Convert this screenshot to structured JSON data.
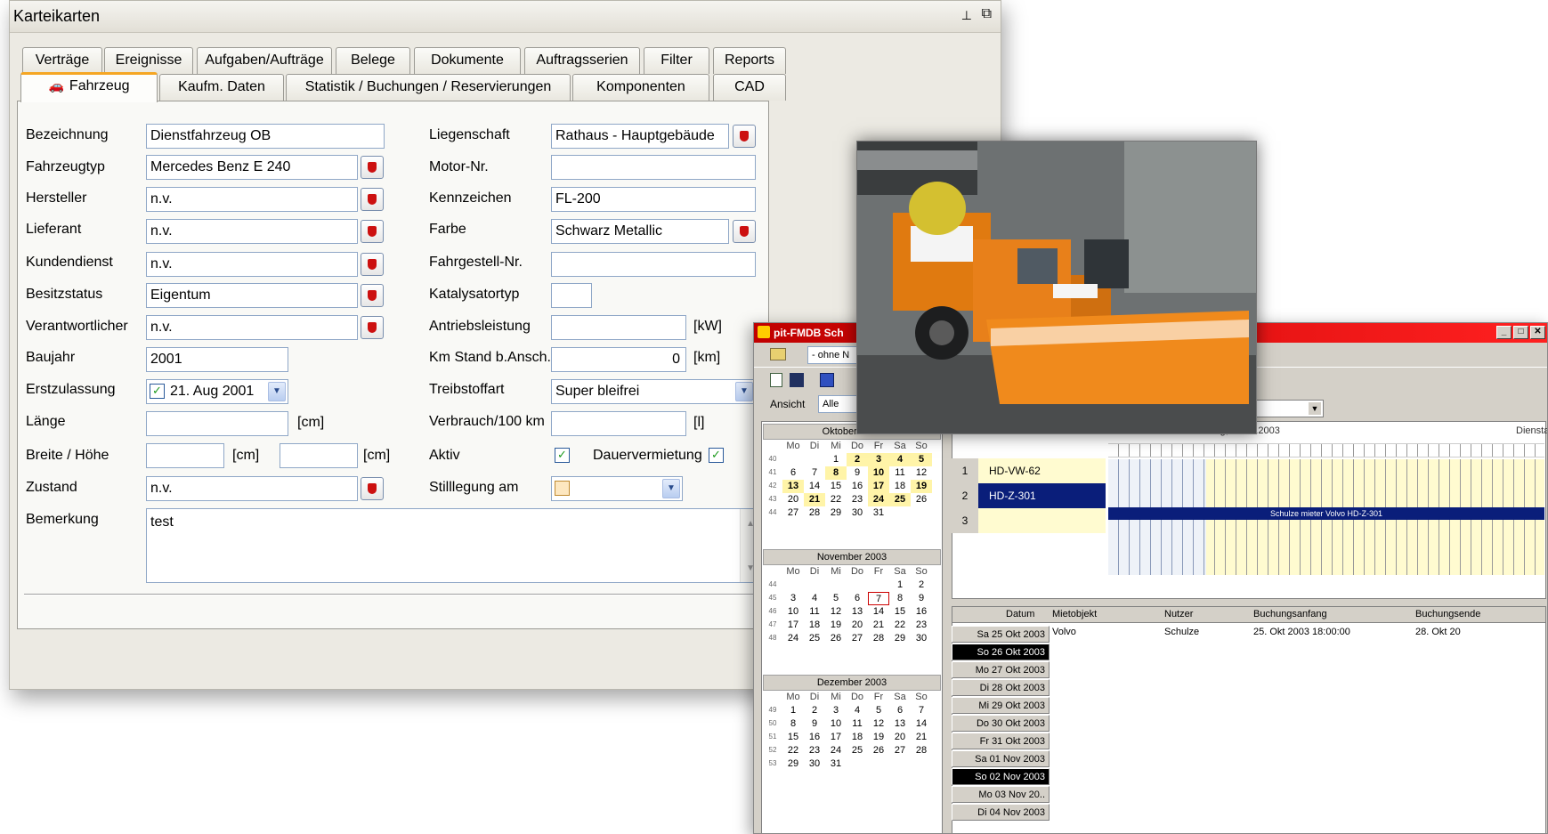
{
  "main_window": {
    "title": "Karteikarten",
    "tabs_row1": [
      "Verträge",
      "Ereignisse",
      "Aufgaben/Aufträge",
      "Belege",
      "Dokumente",
      "Auftragsserien",
      "Filter",
      "Reports"
    ],
    "tabs_row2": [
      "Fahrzeug",
      "Kaufm. Daten",
      "Statistik / Buchungen / Reservierungen",
      "Komponenten",
      "CAD"
    ],
    "form": {
      "bezeichnung_label": "Bezeichnung",
      "bezeichnung": "Dienstfahrzeug OB",
      "fahrzeugtyp_label": "Fahrzeugtyp",
      "fahrzeugtyp": "Mercedes Benz E 240",
      "hersteller_label": "Hersteller",
      "hersteller": "n.v.",
      "lieferant_label": "Lieferant",
      "lieferant": "n.v.",
      "kundendienst_label": "Kundendienst",
      "kundendienst": "n.v.",
      "besitzstatus_label": "Besitzstatus",
      "besitzstatus": "Eigentum",
      "verantwortlicher_label": "Verantwortlicher",
      "verantwortlicher": "n.v.",
      "baujahr_label": "Baujahr",
      "baujahr": "2001",
      "erstzulassung_label": "Erstzulassung",
      "erstzulassung": "21. Aug 2001",
      "laenge_label": "Länge",
      "laenge_unit": "[cm]",
      "breite_label": "Breite / Höhe",
      "breite_unit": "[cm]",
      "hoehe_unit": "[cm]",
      "zustand_label": "Zustand",
      "zustand": "n.v.",
      "bemerkung_label": "Bemerkung",
      "bemerkung": "test",
      "liegenschaft_label": "Liegenschaft",
      "liegenschaft": "Rathaus - Hauptgebäude",
      "motornr_label": "Motor-Nr.",
      "kennzeichen_label": "Kennzeichen",
      "kennzeichen": "FL-200",
      "farbe_label": "Farbe",
      "farbe": "Schwarz Metallic",
      "fahrgestell_label": "Fahrgestell-Nr.",
      "katalysator_label": "Katalysatortyp",
      "antrieb_label": "Antriebsleistung",
      "antrieb_unit": "[kW]",
      "kmstand_label": "Km Stand b.Ansch.",
      "kmstand": "0",
      "kmstand_unit": "[km]",
      "treibstoff_label": "Treibstoffart",
      "treibstoff": "Super bleifrei",
      "verbrauch_label": "Verbrauch/100 km",
      "verbrauch_unit": "[l]",
      "aktiv_label": "Aktiv",
      "dauervermietung_label": "Dauervermietung",
      "stilllegung_label": "Stilllegung am"
    }
  },
  "back_window": {
    "title": "pit-FMDB Sch",
    "ansicht_label": "Ansicht",
    "ansicht_value": "Alle",
    "filter_value": "- ohne N",
    "calendar": [
      {
        "month": "Oktober 2003",
        "weekdays": [
          "Mo",
          "Di",
          "Mi",
          "Do",
          "Fr",
          "Sa",
          "So"
        ],
        "weeks": [
          [
            "40",
            "",
            "",
            "1",
            "2",
            "3",
            "4",
            "5"
          ],
          [
            "41",
            "6",
            "7",
            "8",
            "9",
            "10",
            "11",
            "12"
          ],
          [
            "42",
            "13",
            "14",
            "15",
            "16",
            "17",
            "18",
            "19"
          ],
          [
            "43",
            "20",
            "21",
            "22",
            "23",
            "24",
            "25",
            "26"
          ],
          [
            "44",
            "27",
            "28",
            "29",
            "30",
            "31",
            "",
            ""
          ]
        ]
      },
      {
        "month": "November 2003",
        "weekdays": [
          "Mo",
          "Di",
          "Mi",
          "Do",
          "Fr",
          "Sa",
          "So"
        ],
        "weeks": [
          [
            "44",
            "",
            "",
            "",
            "",
            "",
            "1",
            "2"
          ],
          [
            "45",
            "3",
            "4",
            "5",
            "6",
            "7",
            "8",
            "9"
          ],
          [
            "46",
            "10",
            "11",
            "12",
            "13",
            "14",
            "15",
            "16"
          ],
          [
            "47",
            "17",
            "18",
            "19",
            "20",
            "21",
            "22",
            "23"
          ],
          [
            "48",
            "24",
            "25",
            "26",
            "27",
            "28",
            "29",
            "30"
          ]
        ]
      },
      {
        "month": "Dezember 2003",
        "weekdays": [
          "Mo",
          "Di",
          "Mi",
          "Do",
          "Fr",
          "Sa",
          "So"
        ],
        "weeks": [
          [
            "49",
            "1",
            "2",
            "3",
            "4",
            "5",
            "6",
            "7"
          ],
          [
            "50",
            "8",
            "9",
            "10",
            "11",
            "12",
            "13",
            "14"
          ],
          [
            "51",
            "15",
            "16",
            "17",
            "18",
            "19",
            "20",
            "21"
          ],
          [
            "52",
            "22",
            "23",
            "24",
            "25",
            "26",
            "27",
            "28"
          ],
          [
            "53",
            "29",
            "30",
            "31",
            "",
            "",
            "",
            ""
          ]
        ]
      }
    ],
    "timeline_header": "Montag, 27.10.2003",
    "timeline_header2": "Dienstag",
    "rows": [
      {
        "num": "1",
        "plate": "HD-VW-62"
      },
      {
        "num": "2",
        "plate": "HD-Z-301"
      },
      {
        "num": "3",
        "plate": ""
      }
    ],
    "booking_bar": "Schulze mieter Volvo HD-Z-301",
    "table_headers": [
      "Datum",
      "Mietobjekt",
      "Nutzer",
      "Buchungsanfang",
      "Buchungsende"
    ],
    "first_booking": {
      "mietobjekt": "Volvo",
      "nutzer": "Schulze",
      "anfang": "25. Okt 2003 18:00:00",
      "ende": "28. Okt 20"
    },
    "dates": [
      "Sa 25 Okt 2003",
      "So 26 Okt 2003",
      "Mo 27 Okt 2003",
      "Di 28 Okt 2003",
      "Mi 29 Okt 2003",
      "Do 30 Okt 2003",
      "Fr 31 Okt 2003",
      "Sa 01 Nov 2003",
      "So 02 Nov 2003",
      "Mo 03 Nov 20..",
      "Di 04 Nov 2003"
    ]
  }
}
